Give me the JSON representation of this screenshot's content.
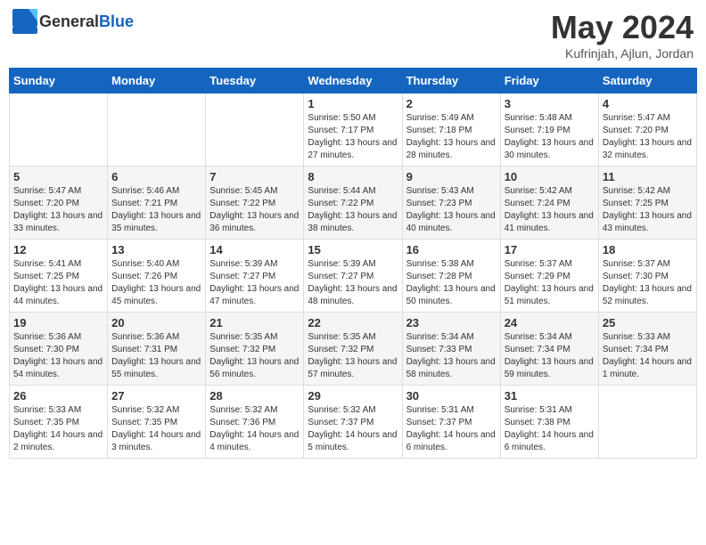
{
  "header": {
    "logo_general": "General",
    "logo_blue": "Blue",
    "title": "May 2024",
    "subtitle": "Kufrinjah, Ajlun, Jordan"
  },
  "days": [
    "Sunday",
    "Monday",
    "Tuesday",
    "Wednesday",
    "Thursday",
    "Friday",
    "Saturday"
  ],
  "weeks": [
    [
      {
        "date": "",
        "sunrise": "",
        "sunset": "",
        "daylight": ""
      },
      {
        "date": "",
        "sunrise": "",
        "sunset": "",
        "daylight": ""
      },
      {
        "date": "",
        "sunrise": "",
        "sunset": "",
        "daylight": ""
      },
      {
        "date": "1",
        "sunrise": "Sunrise: 5:50 AM",
        "sunset": "Sunset: 7:17 PM",
        "daylight": "Daylight: 13 hours and 27 minutes."
      },
      {
        "date": "2",
        "sunrise": "Sunrise: 5:49 AM",
        "sunset": "Sunset: 7:18 PM",
        "daylight": "Daylight: 13 hours and 28 minutes."
      },
      {
        "date": "3",
        "sunrise": "Sunrise: 5:48 AM",
        "sunset": "Sunset: 7:19 PM",
        "daylight": "Daylight: 13 hours and 30 minutes."
      },
      {
        "date": "4",
        "sunrise": "Sunrise: 5:47 AM",
        "sunset": "Sunset: 7:20 PM",
        "daylight": "Daylight: 13 hours and 32 minutes."
      }
    ],
    [
      {
        "date": "5",
        "sunrise": "Sunrise: 5:47 AM",
        "sunset": "Sunset: 7:20 PM",
        "daylight": "Daylight: 13 hours and 33 minutes."
      },
      {
        "date": "6",
        "sunrise": "Sunrise: 5:46 AM",
        "sunset": "Sunset: 7:21 PM",
        "daylight": "Daylight: 13 hours and 35 minutes."
      },
      {
        "date": "7",
        "sunrise": "Sunrise: 5:45 AM",
        "sunset": "Sunset: 7:22 PM",
        "daylight": "Daylight: 13 hours and 36 minutes."
      },
      {
        "date": "8",
        "sunrise": "Sunrise: 5:44 AM",
        "sunset": "Sunset: 7:22 PM",
        "daylight": "Daylight: 13 hours and 38 minutes."
      },
      {
        "date": "9",
        "sunrise": "Sunrise: 5:43 AM",
        "sunset": "Sunset: 7:23 PM",
        "daylight": "Daylight: 13 hours and 40 minutes."
      },
      {
        "date": "10",
        "sunrise": "Sunrise: 5:42 AM",
        "sunset": "Sunset: 7:24 PM",
        "daylight": "Daylight: 13 hours and 41 minutes."
      },
      {
        "date": "11",
        "sunrise": "Sunrise: 5:42 AM",
        "sunset": "Sunset: 7:25 PM",
        "daylight": "Daylight: 13 hours and 43 minutes."
      }
    ],
    [
      {
        "date": "12",
        "sunrise": "Sunrise: 5:41 AM",
        "sunset": "Sunset: 7:25 PM",
        "daylight": "Daylight: 13 hours and 44 minutes."
      },
      {
        "date": "13",
        "sunrise": "Sunrise: 5:40 AM",
        "sunset": "Sunset: 7:26 PM",
        "daylight": "Daylight: 13 hours and 45 minutes."
      },
      {
        "date": "14",
        "sunrise": "Sunrise: 5:39 AM",
        "sunset": "Sunset: 7:27 PM",
        "daylight": "Daylight: 13 hours and 47 minutes."
      },
      {
        "date": "15",
        "sunrise": "Sunrise: 5:39 AM",
        "sunset": "Sunset: 7:27 PM",
        "daylight": "Daylight: 13 hours and 48 minutes."
      },
      {
        "date": "16",
        "sunrise": "Sunrise: 5:38 AM",
        "sunset": "Sunset: 7:28 PM",
        "daylight": "Daylight: 13 hours and 50 minutes."
      },
      {
        "date": "17",
        "sunrise": "Sunrise: 5:37 AM",
        "sunset": "Sunset: 7:29 PM",
        "daylight": "Daylight: 13 hours and 51 minutes."
      },
      {
        "date": "18",
        "sunrise": "Sunrise: 5:37 AM",
        "sunset": "Sunset: 7:30 PM",
        "daylight": "Daylight: 13 hours and 52 minutes."
      }
    ],
    [
      {
        "date": "19",
        "sunrise": "Sunrise: 5:36 AM",
        "sunset": "Sunset: 7:30 PM",
        "daylight": "Daylight: 13 hours and 54 minutes."
      },
      {
        "date": "20",
        "sunrise": "Sunrise: 5:36 AM",
        "sunset": "Sunset: 7:31 PM",
        "daylight": "Daylight: 13 hours and 55 minutes."
      },
      {
        "date": "21",
        "sunrise": "Sunrise: 5:35 AM",
        "sunset": "Sunset: 7:32 PM",
        "daylight": "Daylight: 13 hours and 56 minutes."
      },
      {
        "date": "22",
        "sunrise": "Sunrise: 5:35 AM",
        "sunset": "Sunset: 7:32 PM",
        "daylight": "Daylight: 13 hours and 57 minutes."
      },
      {
        "date": "23",
        "sunrise": "Sunrise: 5:34 AM",
        "sunset": "Sunset: 7:33 PM",
        "daylight": "Daylight: 13 hours and 58 minutes."
      },
      {
        "date": "24",
        "sunrise": "Sunrise: 5:34 AM",
        "sunset": "Sunset: 7:34 PM",
        "daylight": "Daylight: 13 hours and 59 minutes."
      },
      {
        "date": "25",
        "sunrise": "Sunrise: 5:33 AM",
        "sunset": "Sunset: 7:34 PM",
        "daylight": "Daylight: 14 hours and 1 minute."
      }
    ],
    [
      {
        "date": "26",
        "sunrise": "Sunrise: 5:33 AM",
        "sunset": "Sunset: 7:35 PM",
        "daylight": "Daylight: 14 hours and 2 minutes."
      },
      {
        "date": "27",
        "sunrise": "Sunrise: 5:32 AM",
        "sunset": "Sunset: 7:35 PM",
        "daylight": "Daylight: 14 hours and 3 minutes."
      },
      {
        "date": "28",
        "sunrise": "Sunrise: 5:32 AM",
        "sunset": "Sunset: 7:36 PM",
        "daylight": "Daylight: 14 hours and 4 minutes."
      },
      {
        "date": "29",
        "sunrise": "Sunrise: 5:32 AM",
        "sunset": "Sunset: 7:37 PM",
        "daylight": "Daylight: 14 hours and 5 minutes."
      },
      {
        "date": "30",
        "sunrise": "Sunrise: 5:31 AM",
        "sunset": "Sunset: 7:37 PM",
        "daylight": "Daylight: 14 hours and 6 minutes."
      },
      {
        "date": "31",
        "sunrise": "Sunrise: 5:31 AM",
        "sunset": "Sunset: 7:38 PM",
        "daylight": "Daylight: 14 hours and 6 minutes."
      },
      {
        "date": "",
        "sunrise": "",
        "sunset": "",
        "daylight": ""
      }
    ]
  ]
}
